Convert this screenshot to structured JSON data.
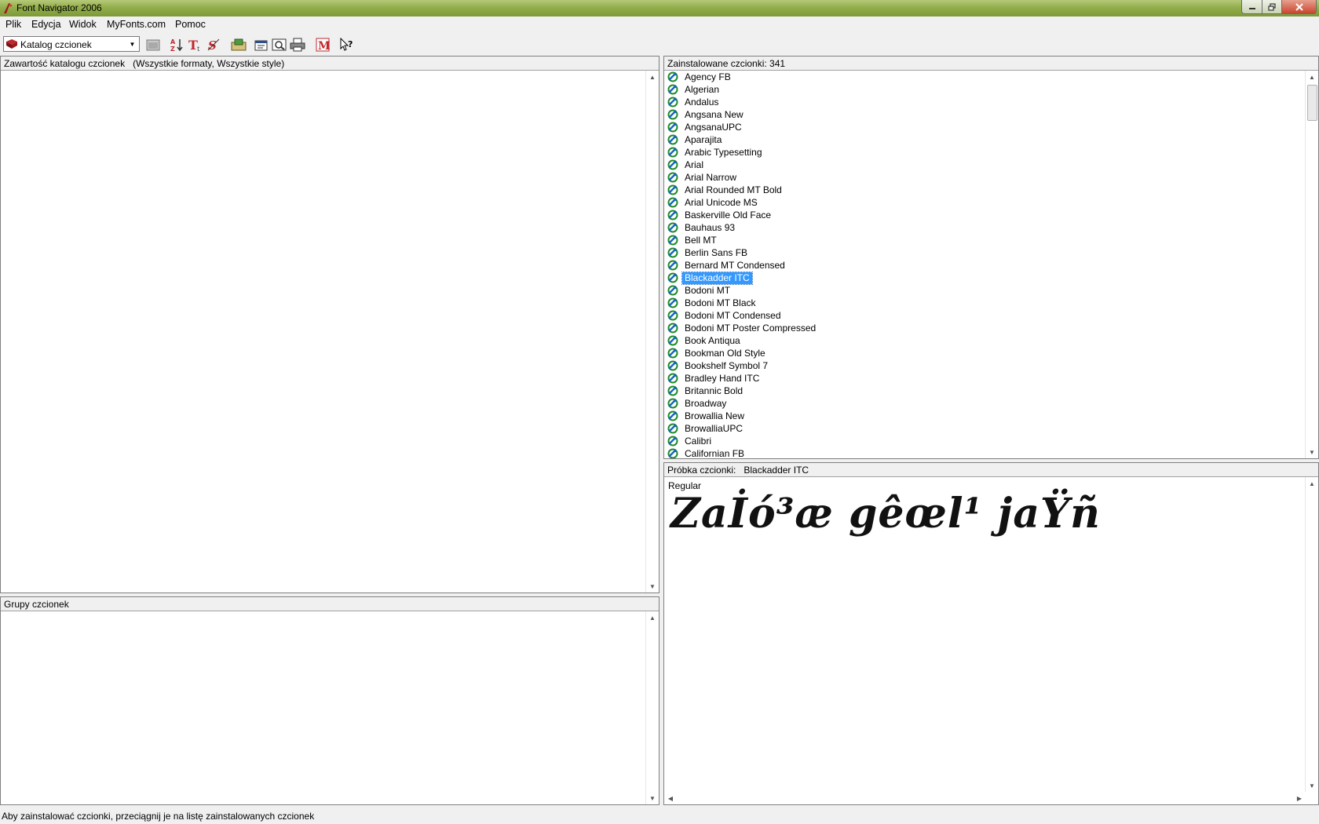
{
  "window": {
    "title": "Font Navigator 2006"
  },
  "menu": [
    "Plik",
    "Edycja",
    "Widok",
    "MyFonts.com",
    "Pomoc"
  ],
  "toolbar": {
    "combo_value": "Katalog czcionek"
  },
  "catalog_panel": {
    "header": "Zawartość katalogu czcionek   (Wszystkie formaty, Wszystkie style)"
  },
  "groups_panel": {
    "header": "Grupy czcionek"
  },
  "installed_panel": {
    "header": "Zainstalowane czcionki: 341",
    "selected": "Blackadder ITC",
    "fonts": [
      "Agency FB",
      "Algerian",
      "Andalus",
      "Angsana New",
      "AngsanaUPC",
      "Aparajita",
      "Arabic Typesetting",
      "Arial",
      "Arial Narrow",
      "Arial Rounded MT Bold",
      "Arial Unicode MS",
      "Baskerville Old Face",
      "Bauhaus 93",
      "Bell MT",
      "Berlin Sans FB",
      "Bernard MT Condensed",
      "Blackadder ITC",
      "Bodoni MT",
      "Bodoni MT Black",
      "Bodoni MT Condensed",
      "Bodoni MT Poster Compressed",
      "Book Antiqua",
      "Bookman Old Style",
      "Bookshelf Symbol 7",
      "Bradley Hand ITC",
      "Britannic Bold",
      "Broadway",
      "Browallia New",
      "BrowalliaUPC",
      "Calibri",
      "Californian FB"
    ]
  },
  "sample_panel": {
    "header": "Próbka czcionki:   Blackadder ITC",
    "style": "Regular",
    "text": "Zaİó³æ gêœl¹ jaŸñ"
  },
  "statusbar": {
    "text": "Aby zainstalować czcionki, przeciągnij je na listę zainstalowanych czcionek"
  },
  "colors": {
    "selection": "#3399ff",
    "titlebar": "#93ae4b",
    "menu_icon_red": "#c0282d"
  }
}
